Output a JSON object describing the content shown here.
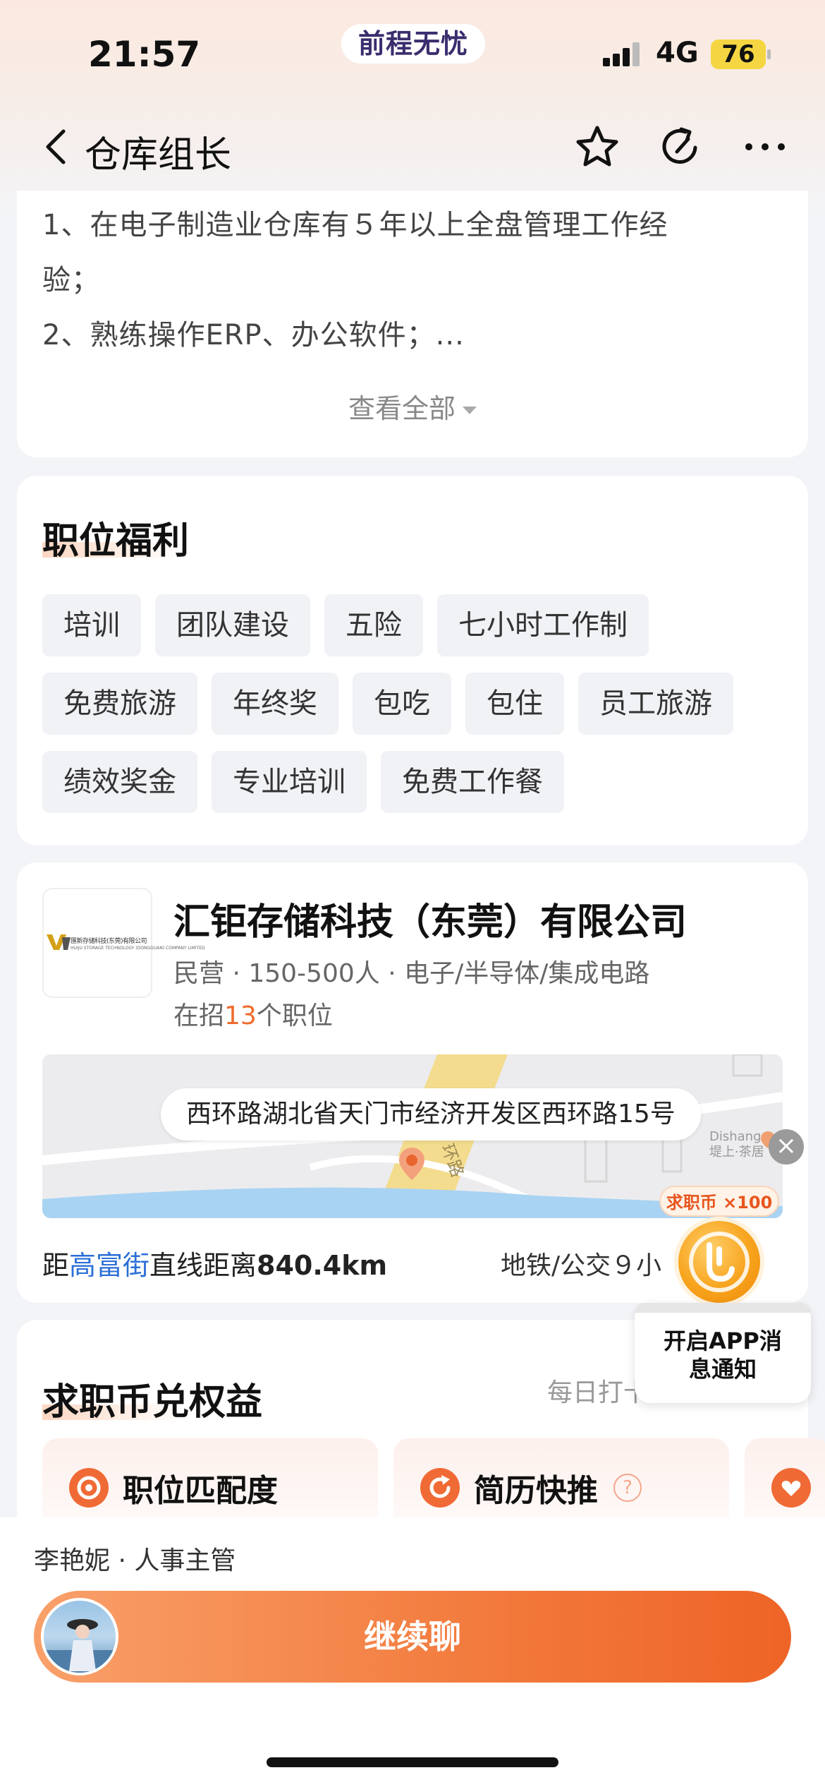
{
  "status_bar": {
    "time": "21:57",
    "app_name": "前程无忧",
    "network": "4G",
    "battery": "76"
  },
  "nav": {
    "title": "仓库组长",
    "icons": [
      "back-icon",
      "favorite-star-icon",
      "share-icon",
      "more-icon"
    ]
  },
  "description": {
    "lines": [
      "1、在电子制造业仓库有５年以上全盘管理工作经",
      "验；",
      "2、熟练操作ERP、办公软件；..."
    ],
    "view_all": "查看全部"
  },
  "benefits": {
    "title": "职位福利",
    "tag_rows": [
      [
        "培训",
        "团队建设",
        "五险",
        "七小时工作制"
      ],
      [
        "免费旅游",
        "年终奖",
        "包吃",
        "包住",
        "员工旅游"
      ],
      [
        "绩效奖金",
        "专业培训",
        "免费工作餐"
      ]
    ]
  },
  "company": {
    "logo_text": "匯新存储科技(东莞)有限公司",
    "logo_sub": "HUIJU STORAGE TECHNOLOGY (DONGGUAN) COMPANY LIMITED",
    "name": "汇钜存储科技（东莞）有限公司",
    "meta": "民营 · 150-500人 · 电子/半导体/集成电路",
    "jobs_prefix": "在招",
    "jobs_count": "13",
    "jobs_suffix": "个职位",
    "address": "西环路湖北省天门市经济开发区西环路15号",
    "map_road_label": "环路",
    "map_poi_en": "Dishang",
    "map_poi_cn": "堤上·茶居",
    "distance_prefix": "距",
    "distance_place": "高富街",
    "distance_middle": "直线距离",
    "distance_value": "840.4km",
    "transit": "地铁/公交９小"
  },
  "float_widget": {
    "coin_badge": "求职币 ×100",
    "notify_text_1": "开启APP消",
    "notify_text_2": "息通知"
  },
  "coin_benefits": {
    "title": "求职币兑权益",
    "daily": "每日打卡",
    "items": [
      {
        "label": "职位匹配度"
      },
      {
        "label": "简历快推"
      }
    ],
    "help": "?"
  },
  "bottom": {
    "recruiter": "李艳妮 · 人事主管",
    "chat_button": "继续聊"
  },
  "colors": {
    "accent": "#ef6a2c",
    "link": "#2b6fd6",
    "tag_bg": "#f1f2f6"
  }
}
